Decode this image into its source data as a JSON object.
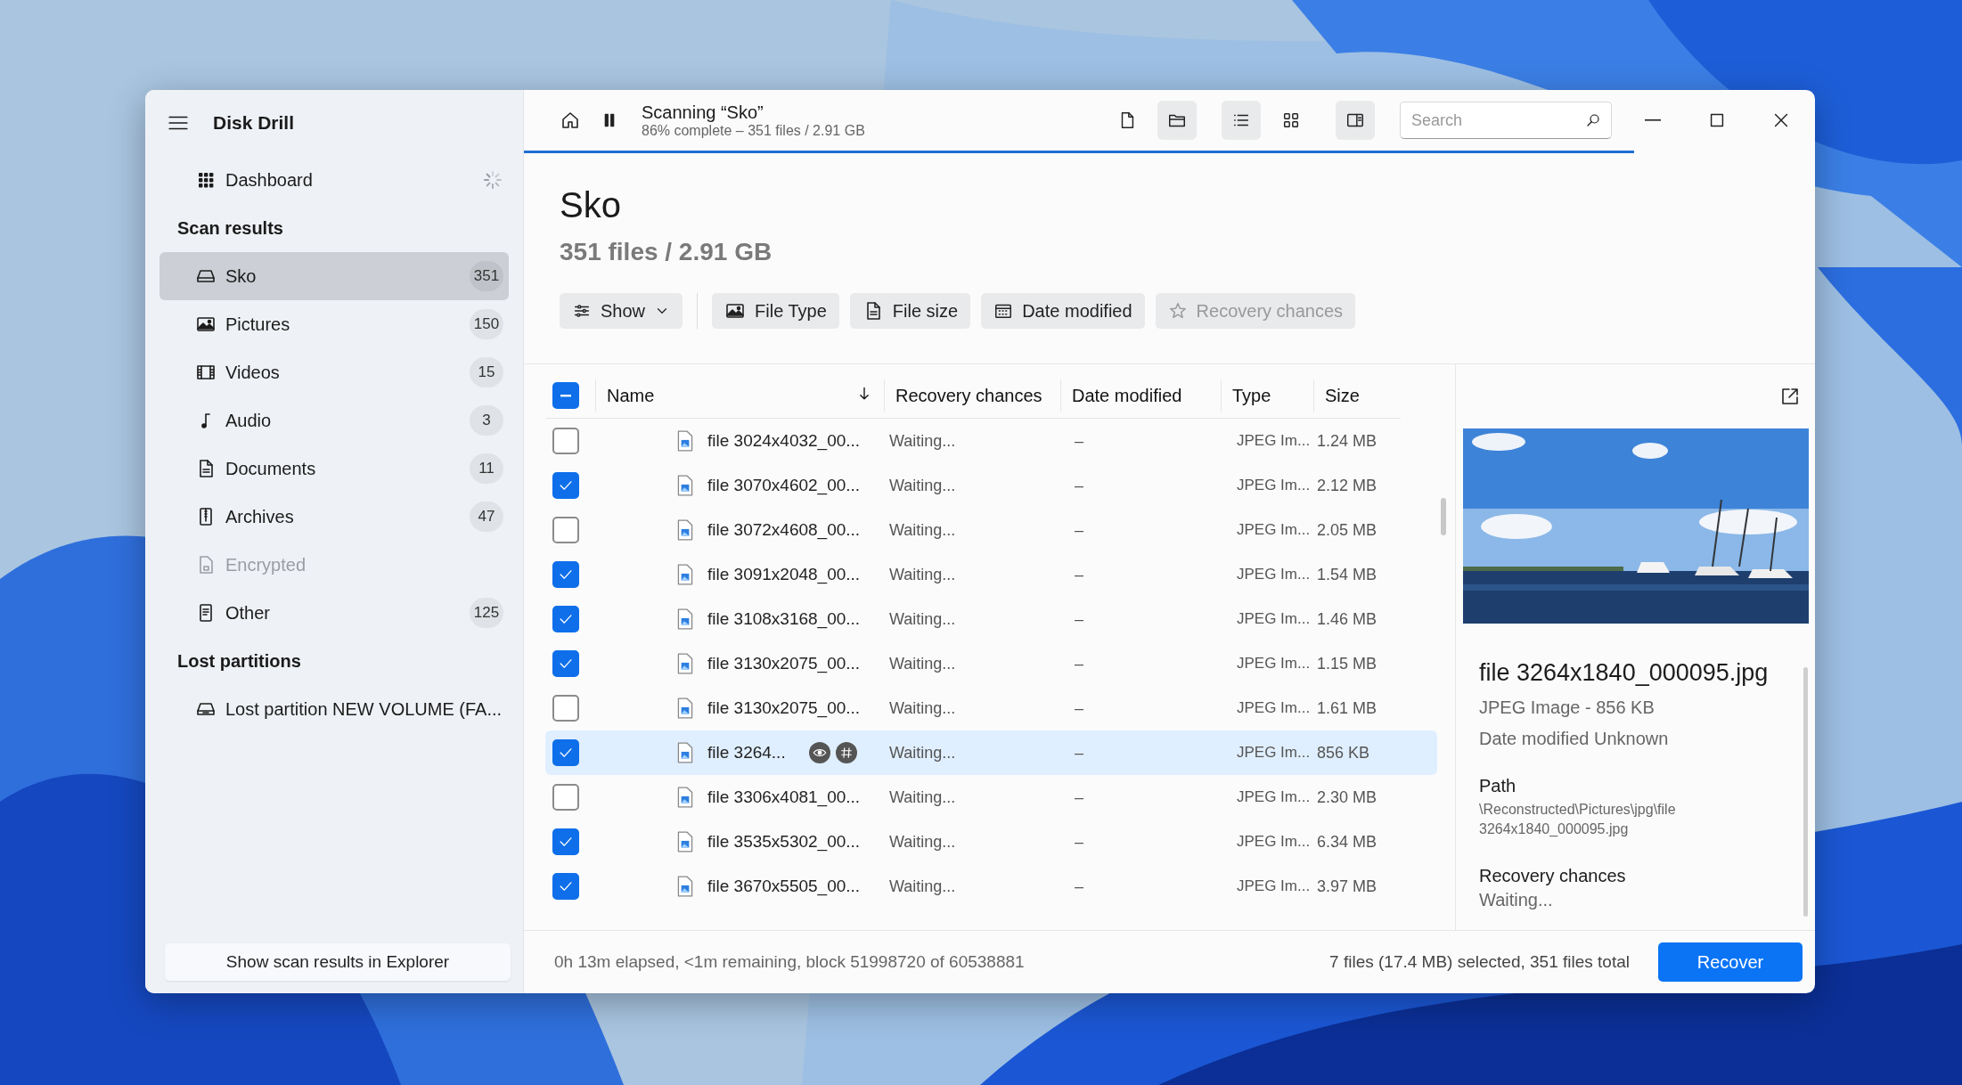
{
  "sidebar": {
    "title": "Disk Drill",
    "dashboard": {
      "label": "Dashboard",
      "busy": true
    },
    "sections": [
      {
        "heading": "Scan results",
        "items": [
          {
            "kind": "drive",
            "label": "Sko",
            "count": "351",
            "selected": true,
            "disabled": false
          },
          {
            "kind": "pictures",
            "label": "Pictures",
            "count": "150",
            "selected": false,
            "disabled": false
          },
          {
            "kind": "videos",
            "label": "Videos",
            "count": "15",
            "selected": false,
            "disabled": false
          },
          {
            "kind": "audio",
            "label": "Audio",
            "count": "3",
            "selected": false,
            "disabled": false
          },
          {
            "kind": "documents",
            "label": "Documents",
            "count": "11",
            "selected": false,
            "disabled": false
          },
          {
            "kind": "archives",
            "label": "Archives",
            "count": "47",
            "selected": false,
            "disabled": false
          },
          {
            "kind": "encrypted",
            "label": "Encrypted",
            "selected": false,
            "disabled": true
          },
          {
            "kind": "other",
            "label": "Other",
            "count": "125",
            "selected": false,
            "disabled": false
          }
        ]
      },
      {
        "heading": "Lost partitions",
        "items": [
          {
            "kind": "partition",
            "label": "Lost partition NEW VOLUME (FA...",
            "selected": false,
            "disabled": false
          }
        ]
      }
    ],
    "footer_button": "Show scan results in Explorer"
  },
  "toolbar": {
    "status_title": "Scanning “Sko”",
    "status_detail": "86% complete – 351 files / 2.91 GB",
    "progress": {
      "level": 0.86
    },
    "view_groups": [
      [
        {
          "kind": "file",
          "selected": false
        },
        {
          "kind": "folder",
          "selected": true
        }
      ],
      [
        {
          "kind": "list",
          "selected": true
        },
        {
          "kind": "grid",
          "selected": false
        }
      ],
      [
        {
          "kind": "preview-pane",
          "selected": true
        }
      ]
    ],
    "search": {
      "placeholder": "Search"
    }
  },
  "content": {
    "title": "Sko",
    "subtitle": "351 files / 2.91 GB",
    "filters": [
      {
        "kind": "show",
        "label": "Show",
        "disabled": false
      },
      {
        "kind": "file-type",
        "label": "File Type",
        "disabled": false
      },
      {
        "kind": "file-size",
        "label": "File size",
        "disabled": false
      },
      {
        "kind": "date",
        "label": "Date modified",
        "disabled": false
      },
      {
        "kind": "recovery",
        "label": "Recovery chances",
        "disabled": true
      }
    ],
    "table": {
      "select_all": {
        "checked": true,
        "indeterminate": true
      },
      "columns": [
        {
          "label": "Name",
          "sorted": true
        },
        {
          "label": "Recovery chances",
          "sorted": false
        },
        {
          "label": "Date modified",
          "sorted": false
        },
        {
          "label": "Type",
          "sorted": false
        },
        {
          "label": "Size",
          "sorted": false
        }
      ],
      "rows": [
        {
          "checked": false,
          "selected": false,
          "name": "file 3024x4032_00...",
          "recovery": "Waiting...",
          "date": "–",
          "type": "JPEG Im...",
          "size": "1.24 MB"
        },
        {
          "checked": true,
          "selected": false,
          "name": "file 3070x4602_00...",
          "recovery": "Waiting...",
          "date": "–",
          "type": "JPEG Im...",
          "size": "2.12 MB"
        },
        {
          "checked": false,
          "selected": false,
          "name": "file 3072x4608_00...",
          "recovery": "Waiting...",
          "date": "–",
          "type": "JPEG Im...",
          "size": "2.05 MB"
        },
        {
          "checked": true,
          "selected": false,
          "name": "file 3091x2048_00...",
          "recovery": "Waiting...",
          "date": "–",
          "type": "JPEG Im...",
          "size": "1.54 MB"
        },
        {
          "checked": true,
          "selected": false,
          "name": "file 3108x3168_00...",
          "recovery": "Waiting...",
          "date": "–",
          "type": "JPEG Im...",
          "size": "1.46 MB"
        },
        {
          "checked": true,
          "selected": false,
          "name": "file 3130x2075_00...",
          "recovery": "Waiting...",
          "date": "–",
          "type": "JPEG Im...",
          "size": "1.15 MB"
        },
        {
          "checked": false,
          "selected": false,
          "name": "file 3130x2075_00...",
          "recovery": "Waiting...",
          "date": "–",
          "type": "JPEG Im...",
          "size": "1.61 MB"
        },
        {
          "checked": true,
          "selected": true,
          "name": "file 3264...",
          "recovery": "Waiting...",
          "date": "–",
          "type": "JPEG Im...",
          "size": "856 KB"
        },
        {
          "checked": false,
          "selected": false,
          "name": "file 3306x4081_00...",
          "recovery": "Waiting...",
          "date": "–",
          "type": "JPEG Im...",
          "size": "2.30 MB"
        },
        {
          "checked": true,
          "selected": false,
          "name": "file 3535x5302_00...",
          "recovery": "Waiting...",
          "date": "–",
          "type": "JPEG Im...",
          "size": "6.34 MB"
        },
        {
          "checked": true,
          "selected": false,
          "name": "file 3670x5505_00...",
          "recovery": "Waiting...",
          "date": "–",
          "type": "JPEG Im...",
          "size": "3.97 MB"
        }
      ]
    }
  },
  "preview": {
    "file_name": "file 3264x1840_000095.jpg",
    "details": [
      "JPEG Image - 856 KB",
      "Date modified Unknown"
    ],
    "fields": [
      {
        "heading": "Path",
        "value": "\\Reconstructed\\Pictures\\jpg\\file 3264x1840_000095.jpg"
      },
      {
        "heading": "Recovery chances",
        "value": "Waiting..."
      }
    ]
  },
  "status_bar": {
    "progress_text": "0h 13m elapsed, <1m remaining, block 51998720 of 60538881",
    "selection_text": "7 files (17.4 MB) selected, 351 files total",
    "recover_button": "Recover"
  }
}
